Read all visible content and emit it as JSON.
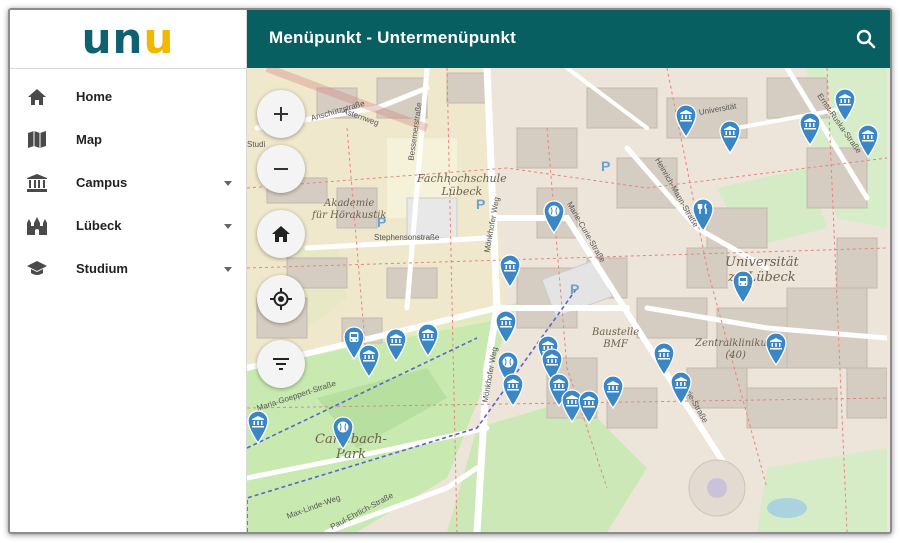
{
  "app": {
    "logo_text": "unu",
    "title": "Menüpunkt - Untermenüpunkt",
    "brand_color": "#085f62",
    "accent_color": "#f0b800"
  },
  "sidebar": {
    "items": [
      {
        "label": "Home",
        "icon": "home-icon",
        "expandable": false
      },
      {
        "label": "Map",
        "icon": "map-icon",
        "expandable": false
      },
      {
        "label": "Campus",
        "icon": "institution-icon",
        "expandable": true
      },
      {
        "label": "Lübeck",
        "icon": "castle-icon",
        "expandable": true
      },
      {
        "label": "Studium",
        "icon": "graduation-cap-icon",
        "expandable": true
      }
    ]
  },
  "map_controls": [
    {
      "name": "zoom-in-button",
      "icon": "plus-icon"
    },
    {
      "name": "zoom-out-button",
      "icon": "minus-icon"
    },
    {
      "name": "home-button",
      "icon": "home-icon"
    },
    {
      "name": "locate-button",
      "icon": "crosshair-icon"
    },
    {
      "name": "filter-button",
      "icon": "filter-icon"
    }
  ],
  "map": {
    "labels": {
      "fh": "Fachhochschule\nLübeck",
      "akademie": "Akademie\nfür Hörakustik",
      "uni": "Universität\nzu Lübeck",
      "baustelle": "Baustelle\nBMF",
      "klinikum": "Zentralklinikum\n(40)",
      "park": "Carlebach-\nPark"
    },
    "streets": {
      "anschutz": "Anschützstraße",
      "bessemer": "Bessemerstraße",
      "stephenson": "Stephensonstraße",
      "moenkhofer1": "Mönkhofer Weg",
      "moenkhofer2": "Mönkhofer Weg",
      "mariecurie": "Marie-Curie-Straße",
      "heinrich": "Heinrich-Mann-Straße",
      "ernst": "Ernst-Ruska-Straße",
      "goeppert": "Maria-Goeppert-Straße",
      "curie2": "Curie-Straße",
      "maxlinde": "Max-Linde-Weg",
      "paulehrlich": "Paul-Ehrlich-Straße",
      "univ": "Universität",
      "asternweg": "Asternweg",
      "studi": "Studi"
    },
    "marker_color": "#3b86c4",
    "markers": [
      {
        "type": "institution"
      },
      {
        "type": "institution"
      },
      {
        "type": "institution"
      },
      {
        "type": "institution"
      },
      {
        "type": "institution"
      },
      {
        "type": "baseball"
      },
      {
        "type": "restaurant"
      },
      {
        "type": "bus"
      },
      {
        "type": "institution"
      },
      {
        "type": "institution"
      },
      {
        "type": "bus"
      },
      {
        "type": "institution"
      },
      {
        "type": "institution"
      },
      {
        "type": "institution"
      },
      {
        "type": "institution"
      },
      {
        "type": "baseball"
      },
      {
        "type": "institution"
      },
      {
        "type": "institution"
      },
      {
        "type": "institution"
      },
      {
        "type": "institution"
      },
      {
        "type": "institution"
      },
      {
        "type": "institution"
      },
      {
        "type": "institution"
      },
      {
        "type": "institution"
      },
      {
        "type": "baseball"
      },
      {
        "type": "institution"
      },
      {
        "type": "institution"
      }
    ]
  }
}
